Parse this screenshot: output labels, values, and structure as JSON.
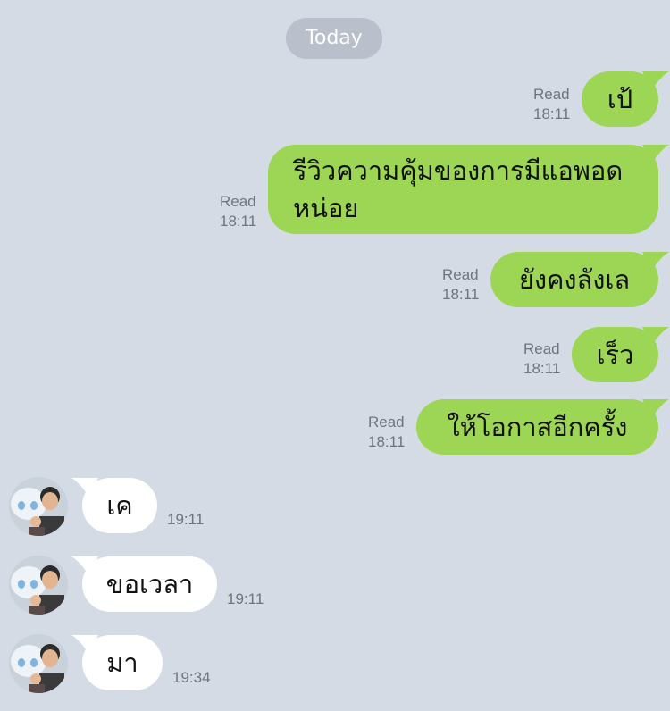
{
  "chat": {
    "date_label": "Today",
    "outgoing": [
      {
        "text": "เป้",
        "status": "Read",
        "time": "18:11"
      },
      {
        "text": "รีวิวความคุ้มของการมีแอพอดหน่อย",
        "line1": "รีวิวความคุ้มของการมีแอพอด",
        "line2": "หน่อย",
        "status": "Read",
        "time": "18:11"
      },
      {
        "text": "ยังคงลังเล",
        "status": "Read",
        "time": "18:11"
      },
      {
        "text": "เร็ว",
        "status": "Read",
        "time": "18:11"
      },
      {
        "text": "ให้โอกาสอีกครั้ง",
        "status": "Read",
        "time": "18:11"
      }
    ],
    "incoming": [
      {
        "text": "เค",
        "time": "19:11"
      },
      {
        "text": "ขอเวลา",
        "time": "19:11"
      },
      {
        "text": "มา",
        "time": "19:34"
      }
    ]
  },
  "colors": {
    "background": "#d4dbe5",
    "outgoing_bubble": "#9cd654",
    "incoming_bubble": "#ffffff",
    "date_pill": "#b9c0cb",
    "meta_text": "#6d7580"
  }
}
